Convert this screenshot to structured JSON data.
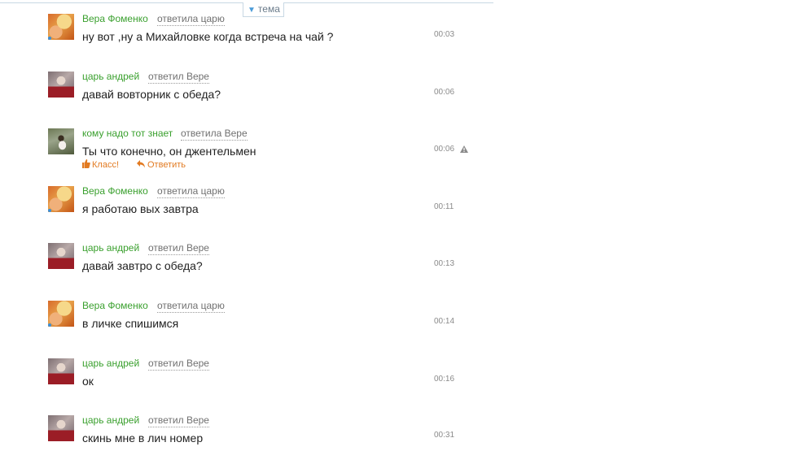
{
  "topic_tab": {
    "label": "тема"
  },
  "messages": [
    {
      "author": "Вера Фоменко",
      "reply": "ответила царю",
      "text": "ну вот ,ну а Михайловке когда встреча на чай ?",
      "time": "00:03"
    },
    {
      "author": "царь андрей",
      "reply": "ответил Вере",
      "text": "давай вовторник с обеда?",
      "time": "00:06"
    },
    {
      "author": "кому надо тот знает",
      "reply": "ответила Вере",
      "text": "Ты что конечно, он джентельмен",
      "time": "00:06",
      "like_label": "Класс!",
      "answer_label": "Ответить"
    },
    {
      "author": "Вера Фоменко",
      "reply": "ответила царю",
      "text": "я работаю вых завтра",
      "time": "00:11"
    },
    {
      "author": "царь андрей",
      "reply": "ответил Вере",
      "text": "давай завтро с обеда?",
      "time": "00:13"
    },
    {
      "author": "Вера Фоменко",
      "reply": "ответила царю",
      "text": "в личке спишимся",
      "time": "00:14"
    },
    {
      "author": "царь андрей",
      "reply": "ответил Вере",
      "text": "ок",
      "time": "00:16"
    },
    {
      "author": "царь андрей",
      "reply": "ответил Вере",
      "text": "скинь мне в лич номер",
      "time": "00:31"
    }
  ]
}
